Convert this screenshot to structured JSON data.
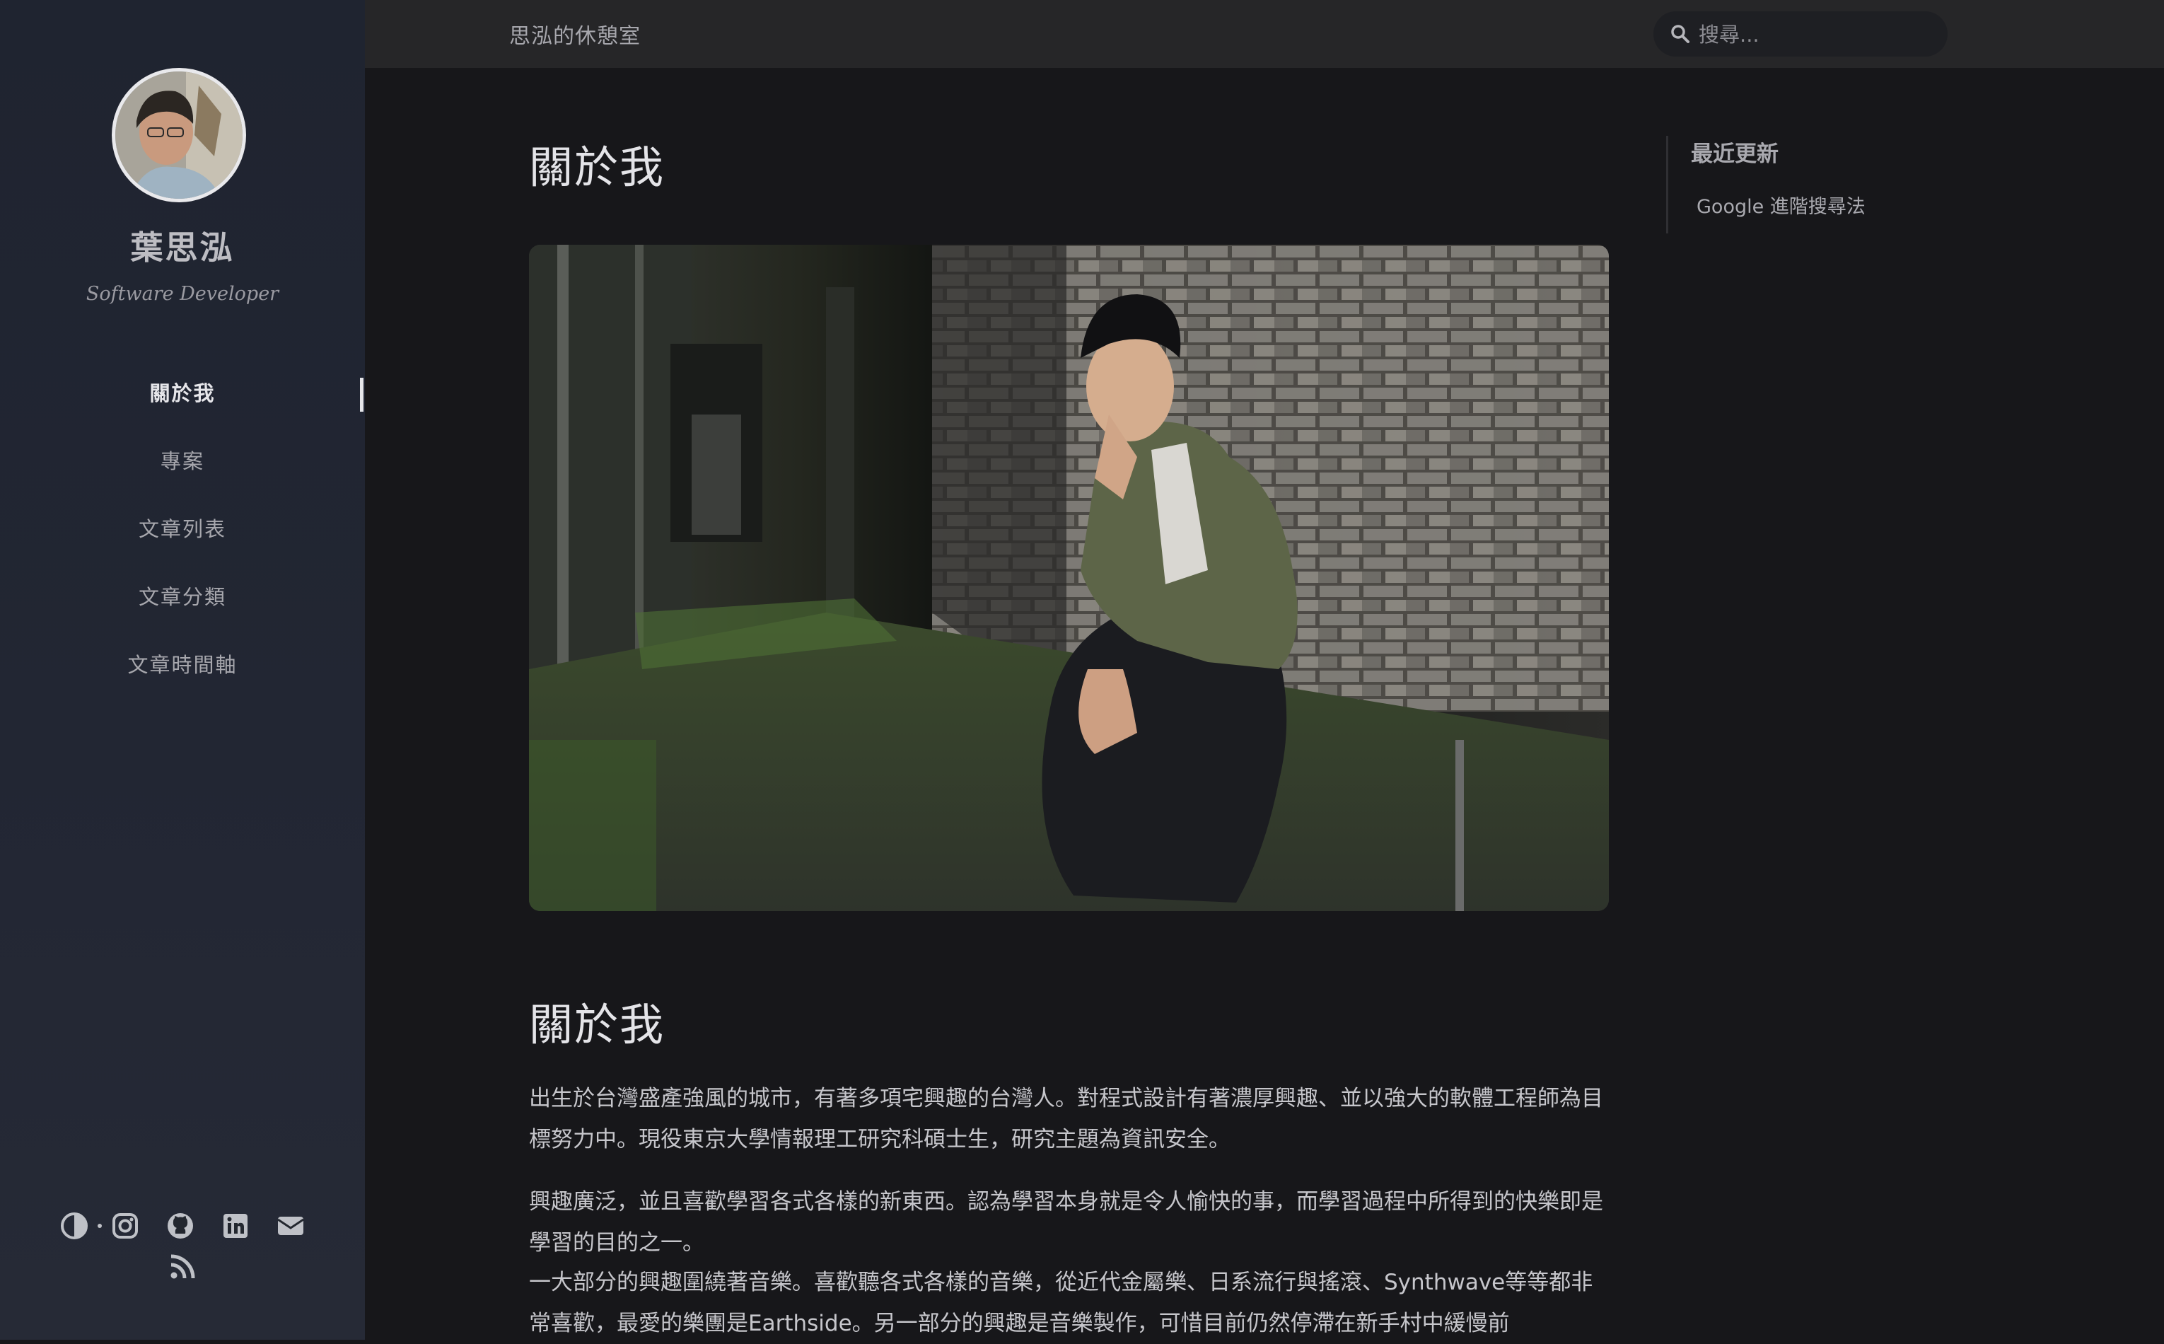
{
  "sidebar": {
    "name": "葉思泓",
    "subtitle": "Software Developer",
    "nav": [
      {
        "label": "關於我",
        "active": true
      },
      {
        "label": "專案"
      },
      {
        "label": "文章列表"
      },
      {
        "label": "文章分類"
      },
      {
        "label": "文章時間軸"
      }
    ],
    "social_icons": [
      "theme-toggle-icon",
      "instagram-icon",
      "github-icon",
      "linkedin-icon",
      "email-icon",
      "rss-icon"
    ]
  },
  "header": {
    "site_title": "思泓的休憩室",
    "search_placeholder": "搜尋..."
  },
  "main": {
    "page_title": "關於我",
    "section_title": "關於我",
    "paragraphs": [
      "出生於台灣盛產強風的城市，有著多項宅興趣的台灣人。對程式設計有著濃厚興趣、並以強大的軟體工程師為目標努力中。現役東京大學情報理工研究科碩士生，研究主題為資訊安全。",
      "興趣廣泛，並且喜歡學習各式各樣的新東西。認為學習本身就是令人愉快的事，而學習過程中所得到的快樂即是學習的目的之一。",
      "一大部分的興趣圍繞著音樂。喜歡聽各式各樣的音樂，從近代金屬樂、日系流行與搖滾、Synthwave等等都非常喜歡，最愛的樂團是Earthside。另一部分的興趣是音樂製作，可惜目前仍然停滯在新手村中緩慢前"
    ]
  },
  "toc": {
    "title": "最近更新",
    "links": [
      "Google 進階搜尋法"
    ]
  },
  "colors": {
    "background": "#17171a",
    "sidebar": "#222633",
    "header": "#262628",
    "text": "#c6c6cb"
  }
}
